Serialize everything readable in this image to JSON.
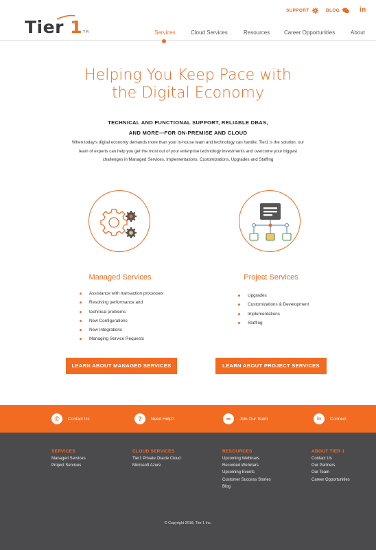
{
  "header": {
    "logo_text": "Tier",
    "logo_number": "1",
    "logo_tm": "TM",
    "utility": [
      {
        "label": "SUPPORT",
        "icon": "gear-icon"
      },
      {
        "label": "BLOG",
        "icon": "chat-icon"
      }
    ],
    "social_label": "in",
    "nav": [
      {
        "label": "Services",
        "active": true
      },
      {
        "label": "Cloud Services",
        "active": false
      },
      {
        "label": "Resources",
        "active": false
      },
      {
        "label": "Career Opportunities",
        "active": false
      },
      {
        "label": "About",
        "active": false
      }
    ]
  },
  "hero": {
    "title_line1": "Helping You Keep Pace with",
    "title_line2": "the Digital Economy",
    "subhead_line1": "TECHNICAL AND FUNCTIONAL SUPPORT, RELIABLE DBAS,",
    "subhead_line2": "AND MORE—FOR ON-PREMISE AND CLOUD",
    "intro_line1": "When today's digital economy demands more than your in-house team and technology can handle, Tier1 is the solution: our",
    "intro_line2": "team of experts can help you get the most out of your enterprise technology investments and overcome your biggest",
    "intro_line3": "challenges in Managed Services, Implementations, Customizations, Upgrades and Staffing"
  },
  "services": {
    "managed": {
      "title": "Managed Services",
      "items": [
        "Assistance with transaction processes",
        "Resolving performance and",
        "technical problems",
        "New Configurations",
        "New Integrations",
        "Managing Service Requests"
      ],
      "button": "LEARN ABOUT MANAGED SERVICES"
    },
    "project": {
      "title": "Project Services",
      "items": [
        "Upgrades",
        "Customizations & Development",
        "Implementations",
        "Staffing"
      ],
      "button": "LEARN ABOUT PROJECT SERVICES"
    }
  },
  "band": [
    {
      "label": "Contact Us",
      "icon": "phone-icon",
      "glyph": "✆"
    },
    {
      "label": "Need Help?",
      "icon": "question-icon",
      "glyph": "?"
    },
    {
      "label": "Join Our Team",
      "icon": "briefcase-icon",
      "glyph": "▬"
    },
    {
      "label": "Connect",
      "icon": "linkedin-icon",
      "glyph": "in"
    }
  ],
  "footer": {
    "columns": [
      {
        "title": "SERVICES",
        "links": [
          "Managed Services",
          "Project Services"
        ]
      },
      {
        "title": "CLOUD SERVICES",
        "links": [
          "Tier1 Private Oracle Cloud",
          "Microsoft Azure"
        ]
      },
      {
        "title": "RESOURCES",
        "links": [
          "Upcoming Webinars",
          "Recorded Webinars",
          "Upcoming Events",
          "Customer Success Stories",
          "Blog"
        ]
      },
      {
        "title": "ABOUT TIER 1",
        "links": [
          "Contact Us",
          "Our Partners",
          "Our Team",
          "Career Opportunities"
        ]
      }
    ],
    "copyright": "© Copyright 2018, Tier 1 Inc."
  },
  "colors": {
    "accent": "#f26b21",
    "footer_bg": "#4b4b4d"
  }
}
